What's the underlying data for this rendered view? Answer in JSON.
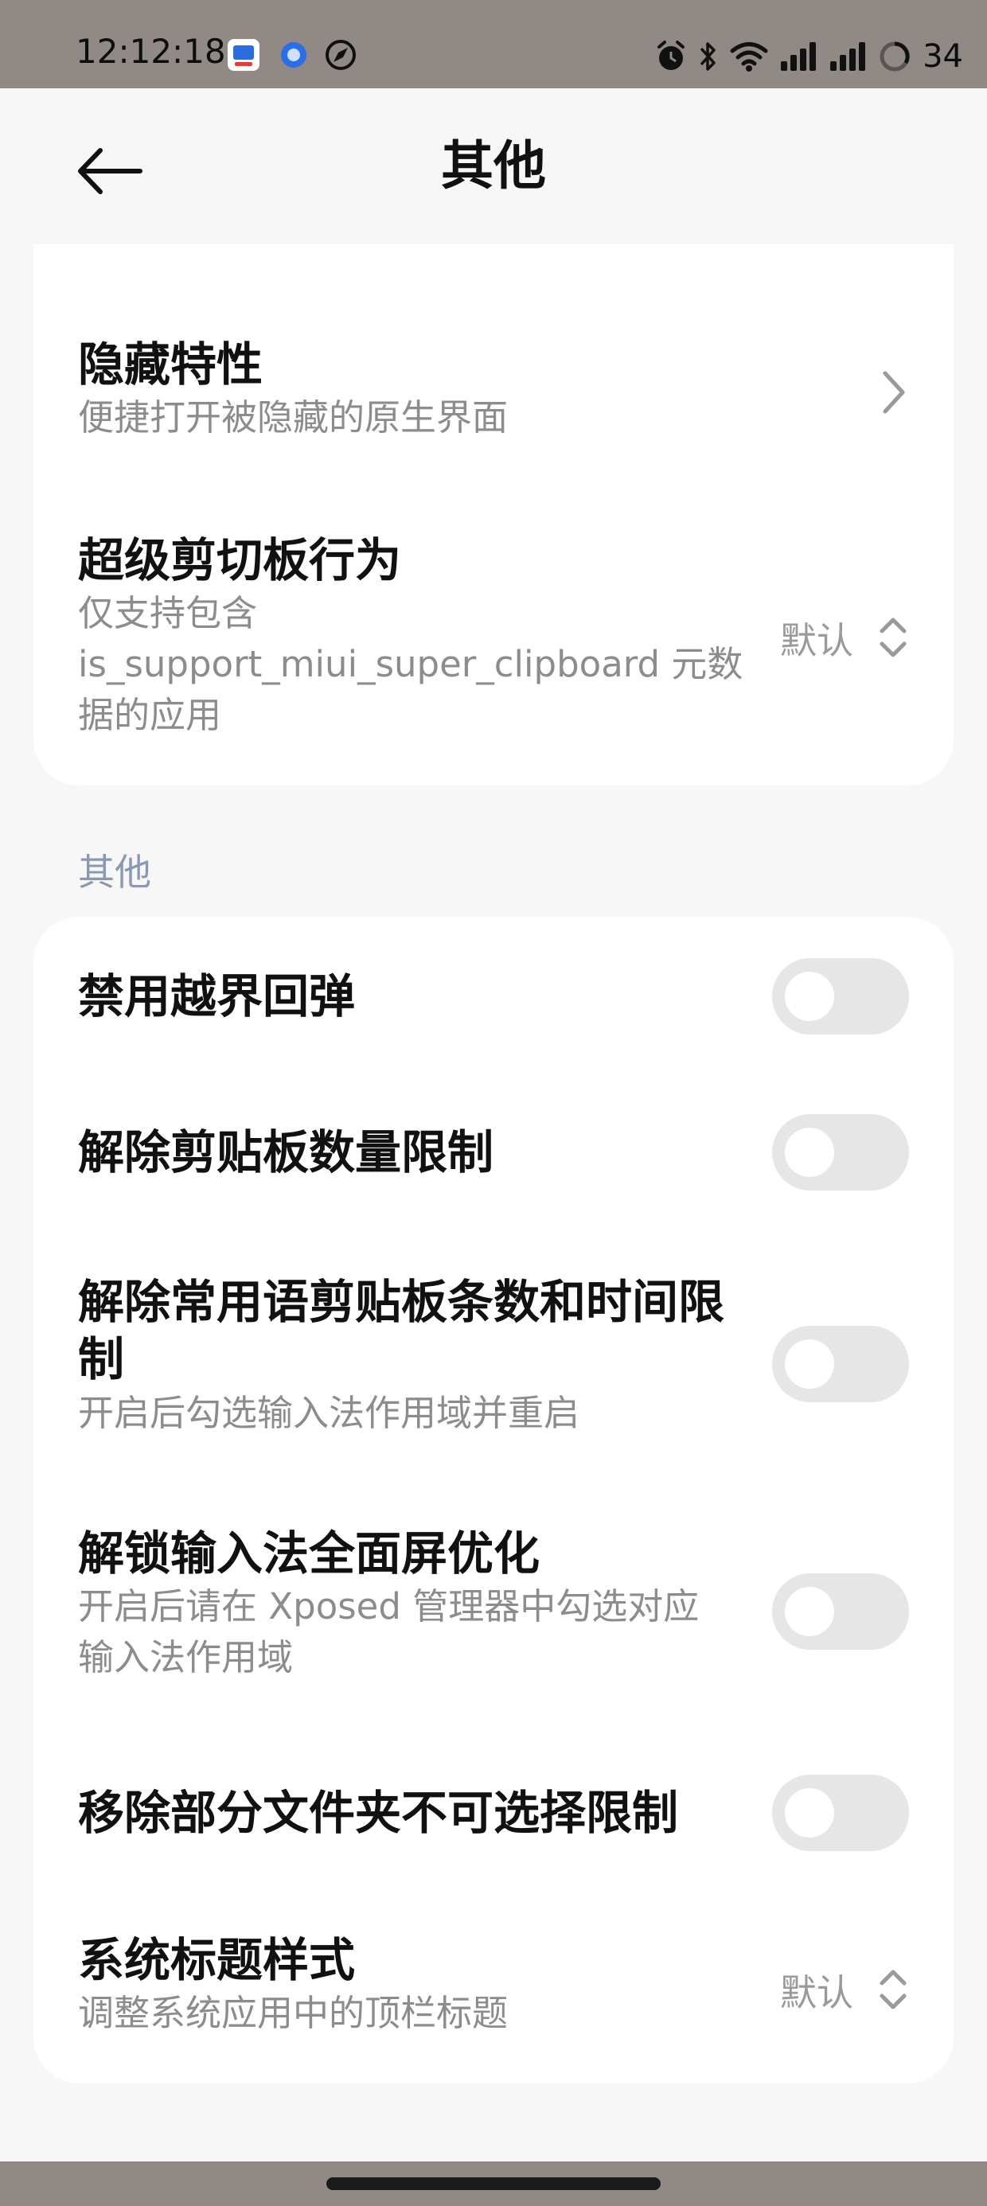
{
  "status": {
    "time": "12:12:18",
    "battery": "34"
  },
  "header": {
    "title": "其他"
  },
  "card1": {
    "hidden_features": {
      "title": "隐藏特性",
      "subtitle": "便捷打开被隐藏的原生界面"
    },
    "super_clipboard": {
      "title": "超级剪切板行为",
      "subtitle_line1": "仅支持包含",
      "subtitle_line2": "is_support_miui_super_clipboard 元数",
      "subtitle_line3": "据的应用",
      "value": "默认"
    }
  },
  "section": {
    "label": "其他"
  },
  "card2": {
    "items": [
      {
        "title": "禁用越界回弹",
        "enabled": false
      },
      {
        "title": "解除剪贴板数量限制",
        "enabled": false
      },
      {
        "title_line1": "解除常用语剪贴板条数和时间限",
        "title_line2": "制",
        "subtitle": "开启后勾选输入法作用域并重启",
        "enabled": false
      },
      {
        "title": "解锁输入法全面屏优化",
        "subtitle_line1": "开启后请在 Xposed 管理器中勾选对应",
        "subtitle_line2": "输入法作用域",
        "enabled": false
      },
      {
        "title": "移除部分文件夹不可选择限制",
        "enabled": false
      }
    ],
    "title_style": {
      "title": "系统标题样式",
      "subtitle": "调整系统应用中的顶栏标题",
      "value": "默认"
    }
  },
  "icons": {
    "status_left": [
      "app-badge-icon",
      "blue-circle-app-icon",
      "compass-icon"
    ],
    "status_right": [
      "alarm-icon",
      "bluetooth-icon",
      "wifi-icon",
      "signal-icon",
      "signal-icon",
      "battery-ring-icon"
    ]
  }
}
